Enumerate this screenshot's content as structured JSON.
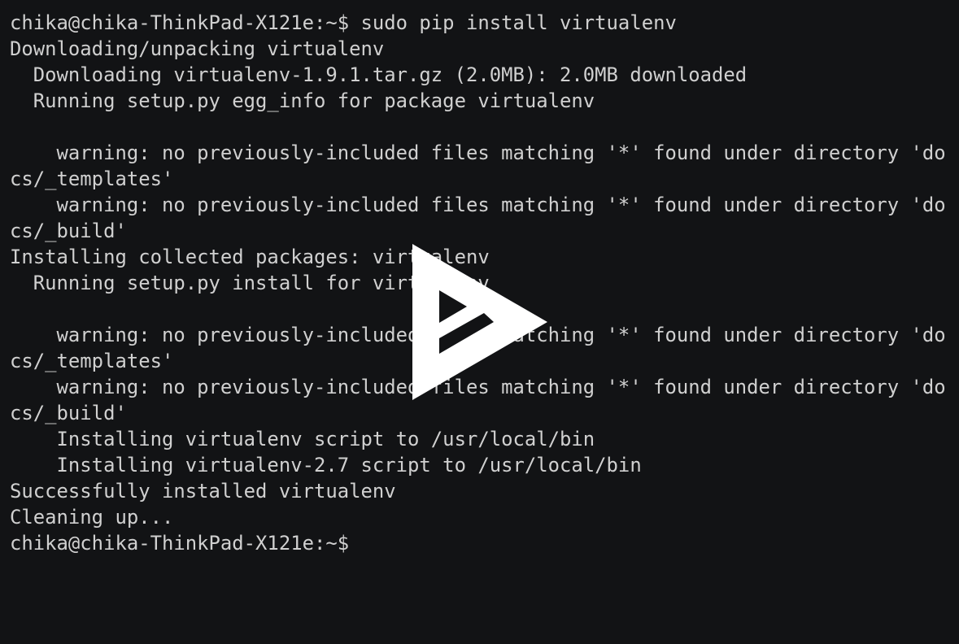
{
  "terminal": {
    "lines": [
      "chika@chika-ThinkPad-X121e:~$ sudo pip install virtualenv",
      "Downloading/unpacking virtualenv",
      "  Downloading virtualenv-1.9.1.tar.gz (2.0MB): 2.0MB downloaded",
      "  Running setup.py egg_info for package virtualenv",
      "",
      "    warning: no previously-included files matching '*' found under directory 'do",
      "cs/_templates'",
      "    warning: no previously-included files matching '*' found under directory 'do",
      "cs/_build'",
      "Installing collected packages: virtualenv",
      "  Running setup.py install for virtualenv",
      "",
      "    warning: no previously-included files matching '*' found under directory 'do",
      "cs/_templates'",
      "    warning: no previously-included files matching '*' found under directory 'do",
      "cs/_build'",
      "    Installing virtualenv script to /usr/local/bin",
      "    Installing virtualenv-2.7 script to /usr/local/bin",
      "Successfully installed virtualenv",
      "Cleaning up...",
      "chika@chika-ThinkPad-X121e:~$"
    ]
  },
  "overlay": {
    "icon": "play-icon",
    "color": "#ffffff"
  },
  "colors": {
    "background": "#121315",
    "text": "#d0d0d0"
  }
}
